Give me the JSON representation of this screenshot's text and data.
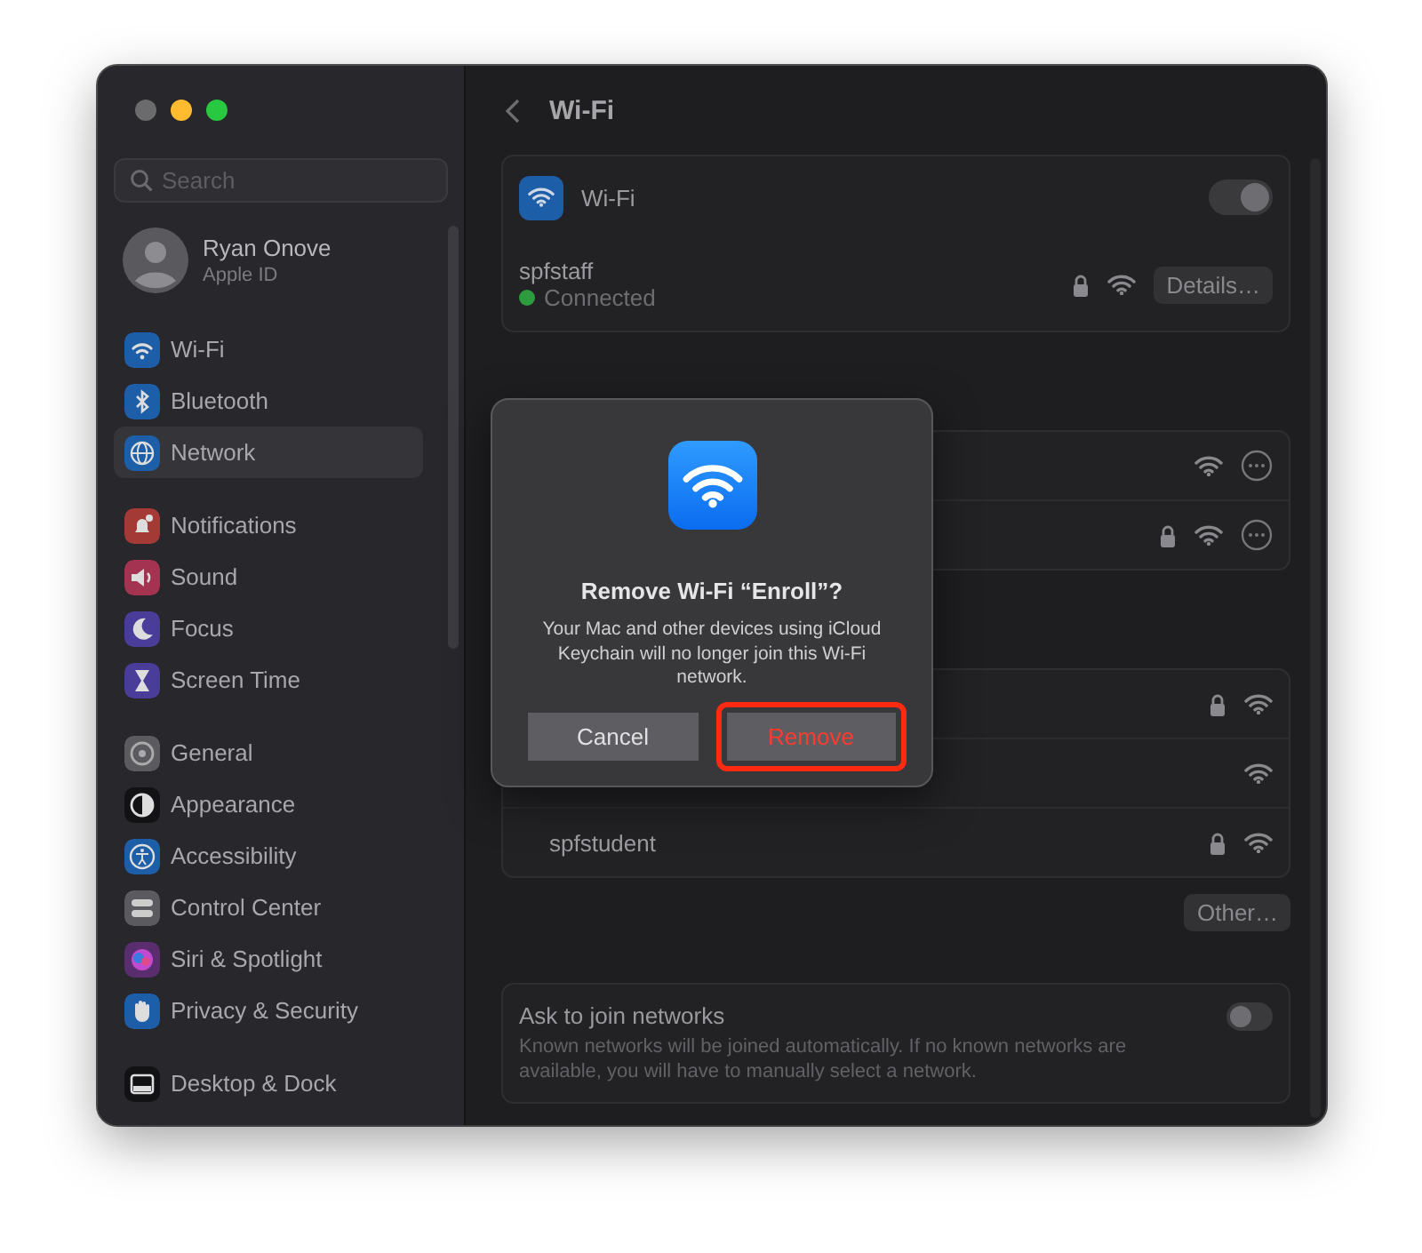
{
  "window": {
    "controls": [
      {
        "color": "#6b6b6e"
      },
      {
        "color": "#febc2e"
      },
      {
        "color": "#28c840"
      }
    ]
  },
  "sidebar": {
    "search": {
      "placeholder": "Search"
    },
    "account": {
      "name": "Ryan Onove",
      "subtitle": "Apple ID"
    },
    "groups": [
      [
        {
          "label": "Wi-Fi",
          "selected": false,
          "color": "#1d5ea8"
        },
        {
          "label": "Bluetooth",
          "selected": false,
          "color": "#1d5ea8"
        },
        {
          "label": "Network",
          "selected": true,
          "color": "#1d5ea8"
        }
      ],
      [
        {
          "label": "Notifications",
          "selected": false,
          "color": "#a33a36"
        },
        {
          "label": "Sound",
          "selected": false,
          "color": "#a33350"
        },
        {
          "label": "Focus",
          "selected": false,
          "color": "#4a3d9a"
        },
        {
          "label": "Screen Time",
          "selected": false,
          "color": "#4a3d9a"
        }
      ],
      [
        {
          "label": "General",
          "selected": false,
          "color": "#5b5b5f"
        },
        {
          "label": "Appearance",
          "selected": false,
          "color": "#121214"
        },
        {
          "label": "Accessibility",
          "selected": false,
          "color": "#1d5ea8"
        },
        {
          "label": "Control Center",
          "selected": false,
          "color": "#5b5b5f"
        },
        {
          "label": "Siri & Spotlight",
          "selected": false,
          "color": "#5a2d6e"
        },
        {
          "label": "Privacy & Security",
          "selected": false,
          "color": "#1d5ea8"
        }
      ],
      [
        {
          "label": "Desktop & Dock",
          "selected": false,
          "color": "#121214"
        }
      ]
    ]
  },
  "header": {
    "title": "Wi-Fi"
  },
  "wifi_card": {
    "label": "Wi-Fi",
    "on": true,
    "network": {
      "name": "spfstaff",
      "status": "Connected",
      "connected": true,
      "secured": true,
      "button": "Details…"
    }
  },
  "known_networks": [
    {
      "secured": false
    },
    {
      "secured": true
    }
  ],
  "other_networks": [
    {
      "secured": true
    },
    {
      "secured": false
    },
    {
      "name": "spfstudent",
      "secured": true
    }
  ],
  "other_button": "Other…",
  "ask_to_join": {
    "title": "Ask to join networks",
    "description": "Known networks will be joined automatically. If no known networks are available, you will have to manually select a network.",
    "on": false
  },
  "dialog": {
    "title": "Remove Wi-Fi “Enroll”?",
    "message": "Your Mac and other devices using iCloud Keychain will no longer join this Wi-Fi network.",
    "buttons": [
      {
        "label": "Cancel",
        "kind": "default",
        "highlighted": false
      },
      {
        "label": "Remove",
        "kind": "destructive",
        "highlighted": true
      }
    ]
  }
}
